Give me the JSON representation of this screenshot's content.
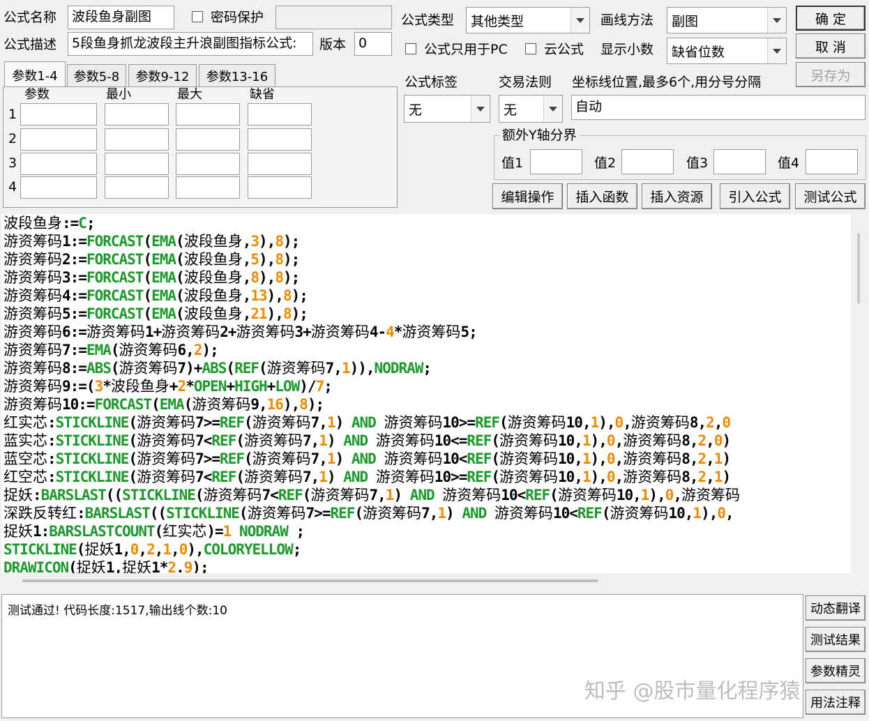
{
  "header": {
    "name_label": "公式名称",
    "name_value": "波段鱼身副图",
    "password_label": "密码保护",
    "desc_label": "公式描述",
    "desc_value": "5段鱼身抓龙波段主升浪副图指标公式:",
    "version_label": "版本",
    "version_value": "0",
    "type_label": "公式类型",
    "type_value": "其他类型",
    "draw_label": "画线方法",
    "draw_value": "副图",
    "pc_only_label": "公式只用于PC",
    "cloud_label": "云公式",
    "decimals_label": "显示小数",
    "decimals_value": "缺省位数"
  },
  "buttons": {
    "ok": "确  定",
    "cancel": "取  消",
    "save_as": "另存为"
  },
  "tabs": [
    "参数1-4",
    "参数5-8",
    "参数9-12",
    "参数13-16"
  ],
  "params": {
    "col_param": "参数",
    "col_min": "最小",
    "col_max": "最大",
    "col_default": "缺省",
    "rows": [
      "1",
      "2",
      "3",
      "4"
    ]
  },
  "tags": {
    "tag_label": "公式标签",
    "tag_value": "无",
    "rule_label": "交易法则",
    "rule_value": "无",
    "coord_label": "坐标线位置,最多6个,用分号分隔",
    "coord_value": "自动"
  },
  "y_axis": {
    "group_label": "额外Y轴分界",
    "v1": "值1",
    "v2": "值2",
    "v3": "值3",
    "v4": "值4"
  },
  "toolbar": {
    "edit": "编辑操作",
    "insert_func": "插入函数",
    "insert_res": "插入资源",
    "import": "引入公式",
    "test": "测试公式"
  },
  "code_lines": [
    [
      [
        "n",
        "波段鱼身"
      ],
      [
        "o",
        ":="
      ],
      [
        "f",
        "C"
      ],
      [
        "o",
        ";"
      ]
    ],
    [
      [
        "n",
        "游资筹码"
      ],
      [
        "o",
        "1:="
      ],
      [
        "f",
        "FORCAST"
      ],
      [
        "o",
        "("
      ],
      [
        "f",
        "EMA"
      ],
      [
        "o",
        "("
      ],
      [
        "n",
        "波段鱼身"
      ],
      [
        "o",
        ","
      ],
      [
        "num",
        "3"
      ],
      [
        "o",
        "),"
      ],
      [
        "num",
        "8"
      ],
      [
        "o",
        ");"
      ]
    ],
    [
      [
        "n",
        "游资筹码"
      ],
      [
        "o",
        "2:="
      ],
      [
        "f",
        "FORCAST"
      ],
      [
        "o",
        "("
      ],
      [
        "f",
        "EMA"
      ],
      [
        "o",
        "("
      ],
      [
        "n",
        "波段鱼身"
      ],
      [
        "o",
        ","
      ],
      [
        "num",
        "5"
      ],
      [
        "o",
        "),"
      ],
      [
        "num",
        "8"
      ],
      [
        "o",
        ");"
      ]
    ],
    [
      [
        "n",
        "游资筹码"
      ],
      [
        "o",
        "3:="
      ],
      [
        "f",
        "FORCAST"
      ],
      [
        "o",
        "("
      ],
      [
        "f",
        "EMA"
      ],
      [
        "o",
        "("
      ],
      [
        "n",
        "波段鱼身"
      ],
      [
        "o",
        ","
      ],
      [
        "num",
        "8"
      ],
      [
        "o",
        "),"
      ],
      [
        "num",
        "8"
      ],
      [
        "o",
        ");"
      ]
    ],
    [
      [
        "n",
        "游资筹码"
      ],
      [
        "o",
        "4:="
      ],
      [
        "f",
        "FORCAST"
      ],
      [
        "o",
        "("
      ],
      [
        "f",
        "EMA"
      ],
      [
        "o",
        "("
      ],
      [
        "n",
        "波段鱼身"
      ],
      [
        "o",
        ","
      ],
      [
        "num",
        "13"
      ],
      [
        "o",
        "),"
      ],
      [
        "num",
        "8"
      ],
      [
        "o",
        ");"
      ]
    ],
    [
      [
        "n",
        "游资筹码"
      ],
      [
        "o",
        "5:="
      ],
      [
        "f",
        "FORCAST"
      ],
      [
        "o",
        "("
      ],
      [
        "f",
        "EMA"
      ],
      [
        "o",
        "("
      ],
      [
        "n",
        "波段鱼身"
      ],
      [
        "o",
        ","
      ],
      [
        "num",
        "21"
      ],
      [
        "o",
        "),"
      ],
      [
        "num",
        "8"
      ],
      [
        "o",
        ");"
      ]
    ],
    [
      [
        "n",
        "游资筹码"
      ],
      [
        "o",
        "6:="
      ],
      [
        "n",
        "游资筹码"
      ],
      [
        "o",
        "1+"
      ],
      [
        "n",
        "游资筹码"
      ],
      [
        "o",
        "2+"
      ],
      [
        "n",
        "游资筹码"
      ],
      [
        "o",
        "3+"
      ],
      [
        "n",
        "游资筹码"
      ],
      [
        "o",
        "4-"
      ],
      [
        "num",
        "4"
      ],
      [
        "o",
        "*"
      ],
      [
        "n",
        "游资筹码"
      ],
      [
        "o",
        "5;"
      ]
    ],
    [
      [
        "n",
        "游资筹码"
      ],
      [
        "o",
        "7:="
      ],
      [
        "f",
        "EMA"
      ],
      [
        "o",
        "("
      ],
      [
        "n",
        "游资筹码"
      ],
      [
        "o",
        "6,"
      ],
      [
        "num",
        "2"
      ],
      [
        "o",
        ");"
      ]
    ],
    [
      [
        "n",
        "游资筹码"
      ],
      [
        "o",
        "8:="
      ],
      [
        "f",
        "ABS"
      ],
      [
        "o",
        "("
      ],
      [
        "n",
        "游资筹码"
      ],
      [
        "o",
        "7)+"
      ],
      [
        "f",
        "ABS"
      ],
      [
        "o",
        "("
      ],
      [
        "f",
        "REF"
      ],
      [
        "o",
        "("
      ],
      [
        "n",
        "游资筹码"
      ],
      [
        "o",
        "7,"
      ],
      [
        "num",
        "1"
      ],
      [
        "o",
        ")),"
      ],
      [
        "f",
        "NODRAW"
      ],
      [
        "o",
        ";"
      ]
    ],
    [
      [
        "n",
        "游资筹码"
      ],
      [
        "o",
        "9:=("
      ],
      [
        "num",
        "3"
      ],
      [
        "o",
        "*"
      ],
      [
        "n",
        "波段鱼身"
      ],
      [
        "o",
        "+"
      ],
      [
        "num",
        "2"
      ],
      [
        "o",
        "*"
      ],
      [
        "f",
        "OPEN"
      ],
      [
        "o",
        "+"
      ],
      [
        "f",
        "HIGH"
      ],
      [
        "o",
        "+"
      ],
      [
        "f",
        "LOW"
      ],
      [
        "o",
        ")/"
      ],
      [
        "num",
        "7"
      ],
      [
        "o",
        ";"
      ]
    ],
    [
      [
        "n",
        "游资筹码"
      ],
      [
        "o",
        "10:="
      ],
      [
        "f",
        "FORCAST"
      ],
      [
        "o",
        "("
      ],
      [
        "f",
        "EMA"
      ],
      [
        "o",
        "("
      ],
      [
        "n",
        "游资筹码"
      ],
      [
        "o",
        "9,"
      ],
      [
        "num",
        "16"
      ],
      [
        "o",
        "),"
      ],
      [
        "num",
        "8"
      ],
      [
        "o",
        ");"
      ]
    ],
    [
      [
        "n",
        "红实芯"
      ],
      [
        "o",
        ":"
      ],
      [
        "f",
        "STICKLINE"
      ],
      [
        "o",
        "("
      ],
      [
        "n",
        "游资筹码"
      ],
      [
        "o",
        "7>="
      ],
      [
        "f",
        "REF"
      ],
      [
        "o",
        "("
      ],
      [
        "n",
        "游资筹码"
      ],
      [
        "o",
        "7,"
      ],
      [
        "num",
        "1"
      ],
      [
        "o",
        ") "
      ],
      [
        "f",
        "AND"
      ],
      [
        "o",
        " "
      ],
      [
        "n",
        "游资筹码"
      ],
      [
        "o",
        "10>="
      ],
      [
        "f",
        "REF"
      ],
      [
        "o",
        "("
      ],
      [
        "n",
        "游资筹码"
      ],
      [
        "o",
        "10,"
      ],
      [
        "num",
        "1"
      ],
      [
        "o",
        "),"
      ],
      [
        "num",
        "0"
      ],
      [
        "o",
        ","
      ],
      [
        "n",
        "游资筹码"
      ],
      [
        "o",
        "8,"
      ],
      [
        "num",
        "2"
      ],
      [
        "o",
        ","
      ],
      [
        "num",
        "0"
      ]
    ],
    [
      [
        "n",
        "蓝实芯"
      ],
      [
        "o",
        ":"
      ],
      [
        "f",
        "STICKLINE"
      ],
      [
        "o",
        "("
      ],
      [
        "n",
        "游资筹码"
      ],
      [
        "o",
        "7<"
      ],
      [
        "f",
        "REF"
      ],
      [
        "o",
        "("
      ],
      [
        "n",
        "游资筹码"
      ],
      [
        "o",
        "7,"
      ],
      [
        "num",
        "1"
      ],
      [
        "o",
        ") "
      ],
      [
        "f",
        "AND"
      ],
      [
        "o",
        " "
      ],
      [
        "n",
        "游资筹码"
      ],
      [
        "o",
        "10<="
      ],
      [
        "f",
        "REF"
      ],
      [
        "o",
        "("
      ],
      [
        "n",
        "游资筹码"
      ],
      [
        "o",
        "10,"
      ],
      [
        "num",
        "1"
      ],
      [
        "o",
        "),"
      ],
      [
        "num",
        "0"
      ],
      [
        "o",
        ","
      ],
      [
        "n",
        "游资筹码"
      ],
      [
        "o",
        "8,"
      ],
      [
        "num",
        "2"
      ],
      [
        "o",
        ","
      ],
      [
        "num",
        "0"
      ],
      [
        "o",
        ")"
      ]
    ],
    [
      [
        "n",
        "蓝空芯"
      ],
      [
        "o",
        ":"
      ],
      [
        "f",
        "STICKLINE"
      ],
      [
        "o",
        "("
      ],
      [
        "n",
        "游资筹码"
      ],
      [
        "o",
        "7>="
      ],
      [
        "f",
        "REF"
      ],
      [
        "o",
        "("
      ],
      [
        "n",
        "游资筹码"
      ],
      [
        "o",
        "7,"
      ],
      [
        "num",
        "1"
      ],
      [
        "o",
        ") "
      ],
      [
        "f",
        "AND"
      ],
      [
        "o",
        " "
      ],
      [
        "n",
        "游资筹码"
      ],
      [
        "o",
        "10<"
      ],
      [
        "f",
        "REF"
      ],
      [
        "o",
        "("
      ],
      [
        "n",
        "游资筹码"
      ],
      [
        "o",
        "10,"
      ],
      [
        "num",
        "1"
      ],
      [
        "o",
        "),"
      ],
      [
        "num",
        "0"
      ],
      [
        "o",
        ","
      ],
      [
        "n",
        "游资筹码"
      ],
      [
        "o",
        "8,"
      ],
      [
        "num",
        "2"
      ],
      [
        "o",
        ","
      ],
      [
        "num",
        "1"
      ],
      [
        "o",
        ")"
      ]
    ],
    [
      [
        "n",
        "红空芯"
      ],
      [
        "o",
        ":"
      ],
      [
        "f",
        "STICKLINE"
      ],
      [
        "o",
        "("
      ],
      [
        "n",
        "游资筹码"
      ],
      [
        "o",
        "7<"
      ],
      [
        "f",
        "REF"
      ],
      [
        "o",
        "("
      ],
      [
        "n",
        "游资筹码"
      ],
      [
        "o",
        "7,"
      ],
      [
        "num",
        "1"
      ],
      [
        "o",
        ") "
      ],
      [
        "f",
        "AND"
      ],
      [
        "o",
        " "
      ],
      [
        "n",
        "游资筹码"
      ],
      [
        "o",
        "10>="
      ],
      [
        "f",
        "REF"
      ],
      [
        "o",
        "("
      ],
      [
        "n",
        "游资筹码"
      ],
      [
        "o",
        "10,"
      ],
      [
        "num",
        "1"
      ],
      [
        "o",
        "),"
      ],
      [
        "num",
        "0"
      ],
      [
        "o",
        ","
      ],
      [
        "n",
        "游资筹码"
      ],
      [
        "o",
        "8,"
      ],
      [
        "num",
        "2"
      ],
      [
        "o",
        ","
      ],
      [
        "num",
        "1"
      ],
      [
        "o",
        ")"
      ]
    ],
    [
      [
        "n",
        "捉妖"
      ],
      [
        "o",
        ":"
      ],
      [
        "f",
        "BARSLAST"
      ],
      [
        "o",
        "(("
      ],
      [
        "f",
        "STICKLINE"
      ],
      [
        "o",
        "("
      ],
      [
        "n",
        "游资筹码"
      ],
      [
        "o",
        "7<"
      ],
      [
        "f",
        "REF"
      ],
      [
        "o",
        "("
      ],
      [
        "n",
        "游资筹码"
      ],
      [
        "o",
        "7,"
      ],
      [
        "num",
        "1"
      ],
      [
        "o",
        ") "
      ],
      [
        "f",
        "AND"
      ],
      [
        "o",
        " "
      ],
      [
        "n",
        "游资筹码"
      ],
      [
        "o",
        "10<"
      ],
      [
        "f",
        "REF"
      ],
      [
        "o",
        "("
      ],
      [
        "n",
        "游资筹码"
      ],
      [
        "o",
        "10,"
      ],
      [
        "num",
        "1"
      ],
      [
        "o",
        "),"
      ],
      [
        "num",
        "0"
      ],
      [
        "o",
        ","
      ],
      [
        "n",
        "游资筹码"
      ]
    ],
    [
      [
        "n",
        "深跌反转红"
      ],
      [
        "o",
        ":"
      ],
      [
        "f",
        "BARSLAST"
      ],
      [
        "o",
        "(("
      ],
      [
        "f",
        "STICKLINE"
      ],
      [
        "o",
        "("
      ],
      [
        "n",
        "游资筹码"
      ],
      [
        "o",
        "7>="
      ],
      [
        "f",
        "REF"
      ],
      [
        "o",
        "("
      ],
      [
        "n",
        "游资筹码"
      ],
      [
        "o",
        "7,"
      ],
      [
        "num",
        "1"
      ],
      [
        "o",
        ") "
      ],
      [
        "f",
        "AND"
      ],
      [
        "o",
        " "
      ],
      [
        "n",
        "游资筹码"
      ],
      [
        "o",
        "10<"
      ],
      [
        "f",
        "REF"
      ],
      [
        "o",
        "("
      ],
      [
        "n",
        "游资筹码"
      ],
      [
        "o",
        "10,"
      ],
      [
        "num",
        "1"
      ],
      [
        "o",
        "),"
      ],
      [
        "num",
        "0"
      ],
      [
        "o",
        ","
      ]
    ],
    [
      [
        "n",
        "捉妖"
      ],
      [
        "o",
        "1:"
      ],
      [
        "f",
        "BARSLASTCOUNT"
      ],
      [
        "o",
        "("
      ],
      [
        "n",
        "红实芯"
      ],
      [
        "o",
        ")="
      ],
      [
        "num",
        "1"
      ],
      [
        "o",
        " "
      ],
      [
        "f",
        "NODRAW"
      ],
      [
        "o",
        " ;"
      ]
    ],
    [
      [
        "f",
        "STICKLINE"
      ],
      [
        "o",
        "("
      ],
      [
        "n",
        "捉妖"
      ],
      [
        "o",
        "1,"
      ],
      [
        "num",
        "0"
      ],
      [
        "o",
        ","
      ],
      [
        "num",
        "2"
      ],
      [
        "o",
        ","
      ],
      [
        "num",
        "1"
      ],
      [
        "o",
        ","
      ],
      [
        "num",
        "0"
      ],
      [
        "o",
        "),"
      ],
      [
        "f",
        "COLORYELLOW"
      ],
      [
        "o",
        ";"
      ]
    ],
    [
      [
        "f",
        "DRAWICON"
      ],
      [
        "o",
        "("
      ],
      [
        "n",
        "捉妖"
      ],
      [
        "o",
        "1,"
      ],
      [
        "n",
        "捉妖"
      ],
      [
        "o",
        "1*"
      ],
      [
        "num",
        "2"
      ],
      [
        "o",
        "."
      ],
      [
        "num",
        "9"
      ],
      [
        "o",
        ");"
      ]
    ]
  ],
  "output": {
    "message": "测试通过! 代码长度:1517,输出线个数:10"
  },
  "side_buttons": [
    "动态翻译",
    "测试结果",
    "参数精灵",
    "用法注释"
  ],
  "watermark": "知乎 @股市量化程序猿",
  "colors": {
    "function": "#1a9a2a",
    "number": "#f08a00",
    "text": "#000000"
  }
}
